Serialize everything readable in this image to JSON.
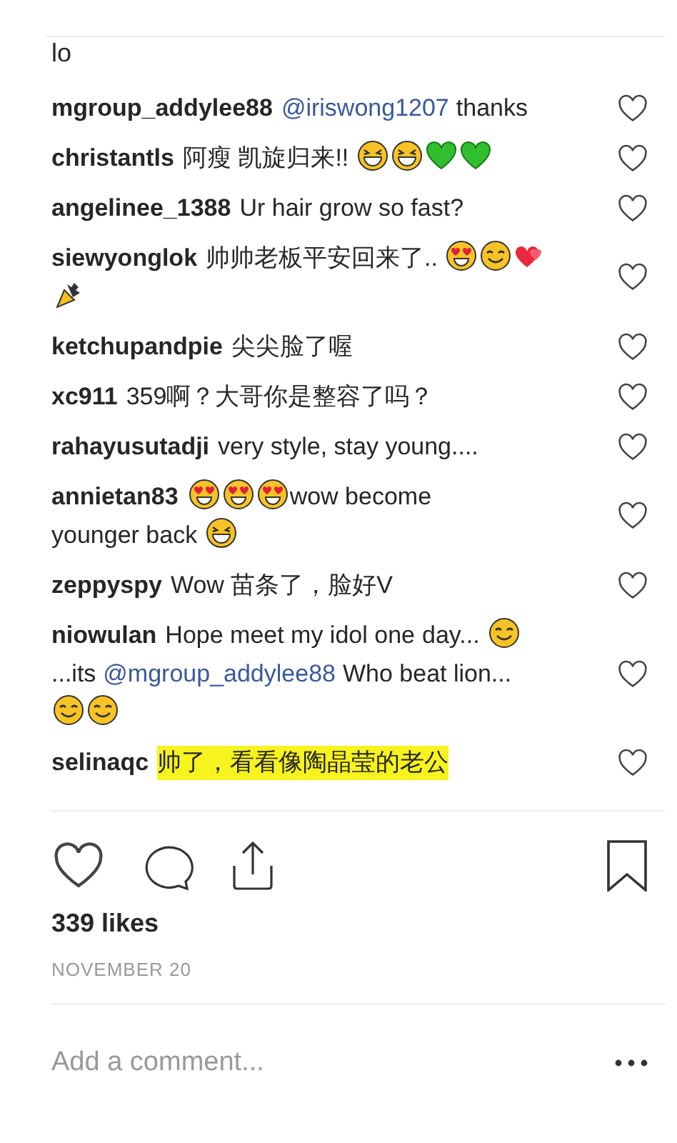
{
  "top_fragment": "lo",
  "comments": [
    {
      "user": "mgroup_addylee88",
      "segments": [
        {
          "kind": "mention",
          "text": "@iriswong1207"
        },
        {
          "kind": "text",
          "text": "thanks"
        }
      ]
    },
    {
      "user": "christantls",
      "segments": [
        {
          "kind": "text",
          "text": "阿瘦 凯旋归来!!"
        },
        {
          "kind": "laugh"
        },
        {
          "kind": "laugh"
        },
        {
          "kind": "greenheart"
        },
        {
          "kind": "greenheart"
        }
      ]
    },
    {
      "user": "angelinee_1388",
      "segments": [
        {
          "kind": "text",
          "text": "Ur hair grow so fast?"
        }
      ]
    },
    {
      "user": "siewyonglok",
      "segments": [
        {
          "kind": "text",
          "text": "帅帅老板平安回来了.."
        },
        {
          "kind": "hearteyes"
        },
        {
          "kind": "smile"
        },
        {
          "kind": "hearts"
        },
        {
          "kind": "popper"
        }
      ]
    },
    {
      "user": "ketchupandpie",
      "segments": [
        {
          "kind": "text",
          "text": "尖尖脸了喔"
        }
      ]
    },
    {
      "user": "xc911",
      "segments": [
        {
          "kind": "text",
          "text": "359啊？大哥你是整容了吗？"
        }
      ]
    },
    {
      "user": "rahayusutadji",
      "segments": [
        {
          "kind": "text",
          "text": "very style, stay young...."
        }
      ]
    },
    {
      "user": "annietan83",
      "segments": [
        {
          "kind": "hearteyes"
        },
        {
          "kind": "hearteyes"
        },
        {
          "kind": "hearteyes"
        },
        {
          "kind": "text",
          "text": "wow become"
        },
        {
          "kind": "text",
          "text": "younger back"
        },
        {
          "kind": "laugh"
        }
      ]
    },
    {
      "user": "zeppyspy",
      "segments": [
        {
          "kind": "text",
          "text": "Wow 苗条了，脸好V"
        }
      ]
    },
    {
      "user": "niowulan",
      "segments": [
        {
          "kind": "text",
          "text": "Hope meet my idol one"
        },
        {
          "kind": "text",
          "text": "day..."
        },
        {
          "kind": "smile"
        },
        {
          "kind": "text",
          "text": "...its"
        },
        {
          "kind": "mention",
          "text": "@mgroup_addylee88"
        },
        {
          "kind": "text",
          "text": "Who beat lion..."
        },
        {
          "kind": "smile"
        },
        {
          "kind": "smile"
        }
      ]
    },
    {
      "user": "selinaqc",
      "segments": [
        {
          "kind": "highlight",
          "text": "帅了，看看像陶晶莹的老公"
        }
      ]
    }
  ],
  "likes": "339 likes",
  "date": "NOVEMBER 20",
  "comment_field": {
    "placeholder": "Add a comment..."
  }
}
